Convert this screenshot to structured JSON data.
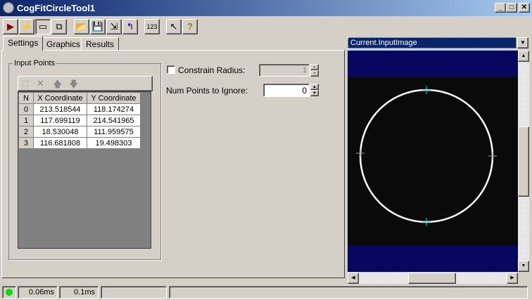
{
  "window": {
    "title": "CogFitCircleTool1"
  },
  "toolbar": {
    "icons": [
      "run-icon",
      "electric-icon",
      "show-controls-icon",
      "float-controls-icon",
      "open-icon",
      "save-icon",
      "save-as-icon",
      "reset-icon",
      "numeric-icon",
      "edit-region-icon",
      "help-icon"
    ]
  },
  "tabs": [
    {
      "label": "Settings"
    },
    {
      "label": "Graphics"
    },
    {
      "label": "Results"
    }
  ],
  "input_points": {
    "group_label": "Input Points",
    "columns": [
      "N",
      "X Coordinate",
      "Y Coordinate"
    ],
    "rows": [
      [
        "0",
        "213.518544",
        "118.174274"
      ],
      [
        "1",
        "117.699119",
        "214.541965"
      ],
      [
        "2",
        "18.530048",
        "111.959575"
      ],
      [
        "3",
        "116.681808",
        "19.498303"
      ]
    ]
  },
  "settings": {
    "constrain_radius_label": "Constrain Radius:",
    "constrain_radius_checked": false,
    "radius_value": "1",
    "num_points_label": "Num Points to Ignore:",
    "num_points_value": "0"
  },
  "display": {
    "image_select": "Current.InputImage"
  },
  "status": {
    "time1": "0.06ms",
    "time2": "0.1ms",
    "indicator_color": "#00e000"
  }
}
